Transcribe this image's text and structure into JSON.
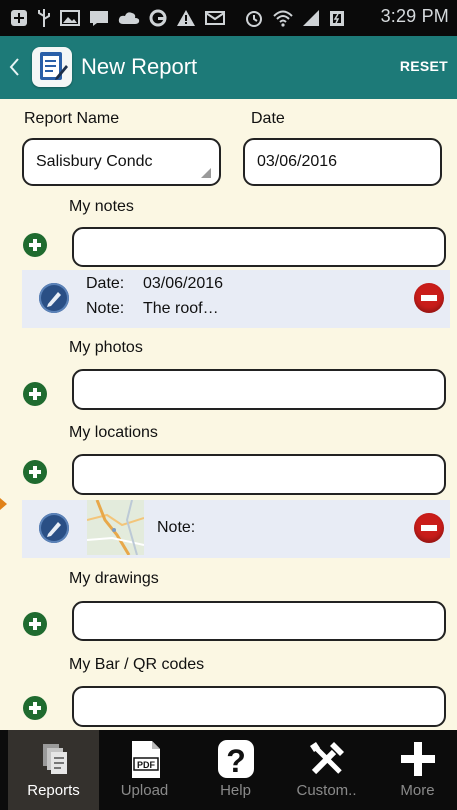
{
  "status_bar": {
    "time": "3:29 PM",
    "icons": [
      "add-notification-icon",
      "usb-icon",
      "gallery-icon",
      "message-icon",
      "cloud-icon",
      "sync-icon",
      "warning-icon",
      "email-icon",
      "alarm-icon",
      "wifi-icon",
      "signal-icon",
      "battery-icon"
    ]
  },
  "action_bar": {
    "title": "New Report",
    "reset_label": "RESET",
    "back_icon": "chevron-left-icon",
    "app_icon": "report-app-icon"
  },
  "form": {
    "report_name_label": "Report Name",
    "report_name_value": "Salisbury Condc",
    "date_label": "Date",
    "date_value": "03/06/2016",
    "notes": {
      "label": "My notes",
      "input_value": "",
      "entries": [
        {
          "date_label": "Date:",
          "date_value": "03/06/2016",
          "note_label": "Note:",
          "note_value": "The roof…"
        }
      ]
    },
    "photos": {
      "label": "My photos",
      "input_value": ""
    },
    "locations": {
      "label": "My locations",
      "input_value": "",
      "entries": [
        {
          "note_label": "Note:",
          "thumbnail": "map-thumbnail"
        }
      ]
    },
    "drawings": {
      "label": "My drawings",
      "input_value": ""
    },
    "codes": {
      "label": "My Bar / QR codes",
      "input_value": ""
    }
  },
  "tab_bar": {
    "tabs": [
      {
        "label": "Reports",
        "icon": "reports-icon",
        "active": true
      },
      {
        "label": "Upload",
        "icon": "pdf-upload-icon",
        "active": false
      },
      {
        "label": "Help",
        "icon": "help-icon",
        "active": false
      },
      {
        "label": "Custom..",
        "icon": "tools-icon",
        "active": false
      },
      {
        "label": "More",
        "icon": "plus-icon",
        "active": false
      }
    ]
  },
  "colors": {
    "action_bar": "#1d7a78",
    "background": "#fbf7e3",
    "add_button": "#1f6b2f",
    "remove_button": "#c91d1a",
    "edit_button": "#2a4f85",
    "tab_bar": "#0c0c0c"
  }
}
